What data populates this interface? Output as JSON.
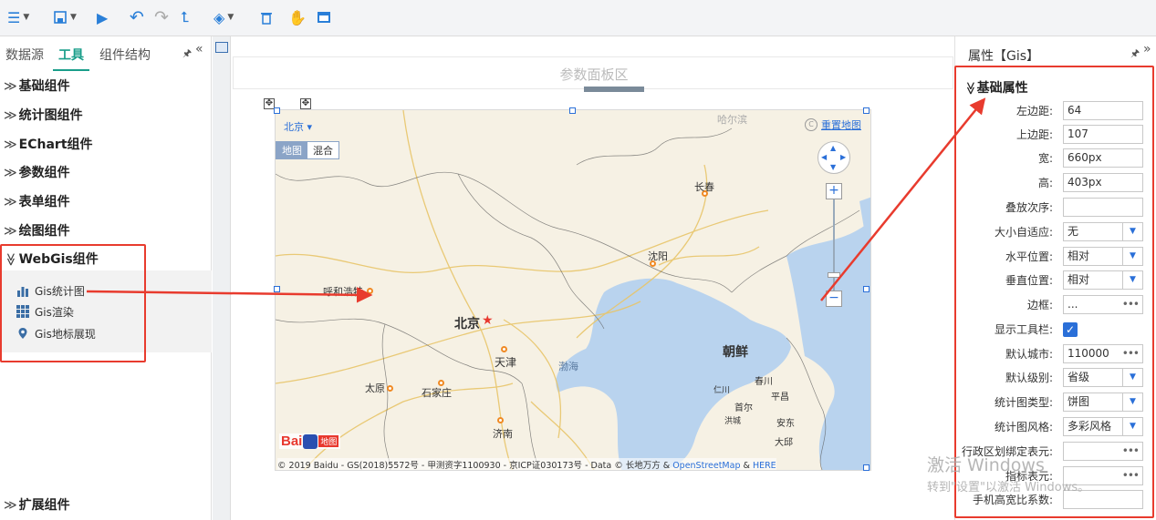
{
  "toolbar": {
    "icons": [
      "menu-icon",
      "save-icon",
      "play-icon",
      "undo-icon",
      "redo-icon",
      "upload-icon",
      "paint-bucket-icon",
      "delete-icon",
      "hand-icon",
      "preview-icon"
    ]
  },
  "left_panel": {
    "tabs": [
      "数据源",
      "工具",
      "组件结构"
    ],
    "active_tab": "工具",
    "categories": [
      "基础组件",
      "统计图组件",
      "EChart组件",
      "参数组件",
      "表单组件",
      "绘图组件",
      "WebGis组件"
    ],
    "expanded_category": "WebGis组件",
    "webgis_items": [
      "Gis统计图",
      "Gis渲染",
      "Gis地标展现"
    ],
    "bottom_category": "扩展组件",
    "chev_collapsed": "≫",
    "chev_expanded": "≫"
  },
  "center": {
    "param_panel_title": "参数面板区",
    "map": {
      "city_selector": "北京 ▾",
      "reset_button": "重置地图",
      "type_tabs": [
        "地图",
        "混合"
      ],
      "cities": [
        "呼和浩特",
        "北京",
        "天津",
        "沈阳",
        "长春",
        "太原",
        "石家庄",
        "济南",
        "渤海",
        "朝鲜",
        "哈尔滨",
        "春川",
        "首尔",
        "平昌",
        "洪城",
        "安东",
        "大邱",
        "仁川"
      ],
      "logo_text": "Bai",
      "logo_text2": "地图",
      "copyright": "© 2019 Baidu - GS(2018)5572号 - 甲测资字1100930 - 京ICP证030173号 - Data © 长地万方 & ",
      "copyright_osm": "OpenStreetMap",
      "copyright_amp": " & ",
      "copyright_here": "HERE"
    }
  },
  "right_panel": {
    "title": "属性【Gis】",
    "section": "基础属性",
    "fields": [
      {
        "label": "左边距:",
        "value": "64",
        "kind": "text"
      },
      {
        "label": "上边距:",
        "value": "107",
        "kind": "text"
      },
      {
        "label": "宽:",
        "value": "660px",
        "kind": "text"
      },
      {
        "label": "高:",
        "value": "403px",
        "kind": "text"
      },
      {
        "label": "叠放次序:",
        "value": "",
        "kind": "text"
      },
      {
        "label": "大小自适应:",
        "value": "无",
        "kind": "select"
      },
      {
        "label": "水平位置:",
        "value": "相对",
        "kind": "select"
      },
      {
        "label": "垂直位置:",
        "value": "相对",
        "kind": "select"
      },
      {
        "label": "边框:",
        "value": "...",
        "kind": "dots"
      },
      {
        "label": "显示工具栏:",
        "value": "✓",
        "kind": "checkbox"
      },
      {
        "label": "默认城市:",
        "value": "110000",
        "kind": "dots"
      },
      {
        "label": "默认级别:",
        "value": "省级",
        "kind": "select"
      },
      {
        "label": "统计图类型:",
        "value": "饼图",
        "kind": "select"
      },
      {
        "label": "统计图风格:",
        "value": "多彩风格",
        "kind": "select"
      },
      {
        "label": "行政区划绑定表元:",
        "value": "",
        "kind": "dots"
      },
      {
        "label": "指标表元:",
        "value": "",
        "kind": "dots"
      },
      {
        "label": "手机高宽比系数:",
        "value": "",
        "kind": "text"
      }
    ],
    "dots_text": "•••",
    "select_arrow": "▼"
  },
  "watermark": {
    "line1": "激活 Windows",
    "line2": "转到\"设置\"以激活 Windows。"
  },
  "colors": {
    "accent": "#1a9e8a",
    "highlight_red": "#e83b2e",
    "blue": "#2a6fd8",
    "map_water": "#b9d3ee",
    "map_land": "#f6f1e4"
  }
}
